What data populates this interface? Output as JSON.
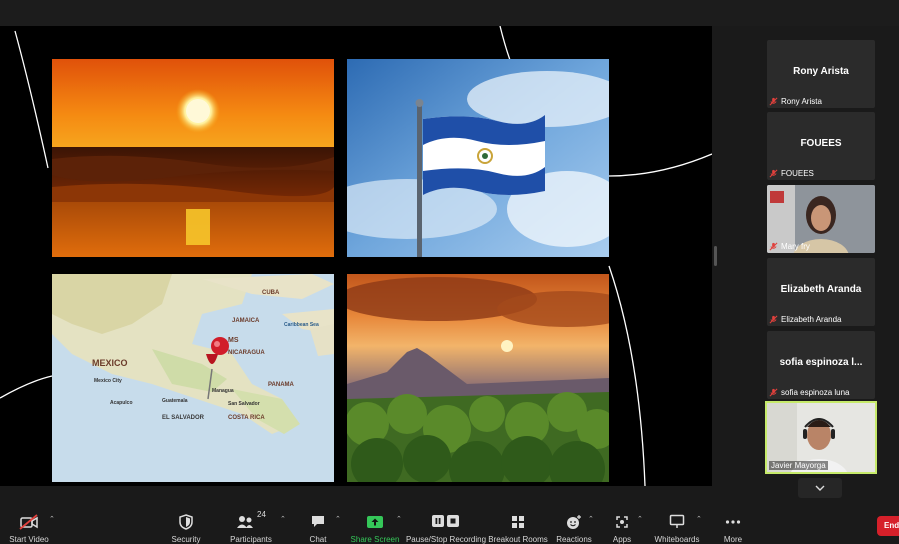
{
  "participants": [
    {
      "display_name": "Rony Arista",
      "label": "Rony Arista"
    },
    {
      "display_name": "FOUEES",
      "label": "FOUEES"
    },
    {
      "label": "Mary fry"
    },
    {
      "display_name": "Elizabeth Aranda",
      "label": "Elizabeth Aranda"
    },
    {
      "display_name": "sofia espinoza l...",
      "label": "sofia espinoza luna"
    }
  ],
  "self_view": {
    "label": "Javier Mayorga"
  },
  "toolbar": {
    "start_video": "Start Video",
    "security": "Security",
    "participants": "Participants",
    "participants_count": "24",
    "chat": "Chat",
    "share_screen": "Share Screen",
    "pause_recording": "Pause/Stop Recording",
    "breakout_rooms": "Breakout Rooms",
    "reactions": "Reactions",
    "apps": "Apps",
    "whiteboards": "Whiteboards",
    "more": "More",
    "end": "End"
  },
  "map_labels": {
    "mexico": "MEXICO",
    "mexico_city": "Mexico City",
    "guatemala": "Guatemala",
    "el_salvador": "EL SALVADOR",
    "san_salvador": "San Salvador",
    "nicaragua": "NICARAGUA",
    "managua": "Managua",
    "costa_rica": "COSTA RICA",
    "panama": "PANAMA",
    "jamaica": "JAMAICA",
    "caribbean_sea": "Caribbean Sea",
    "acapulco": "Acapulco",
    "cuba": "CUBA",
    "honduras": "MS"
  },
  "colors": {
    "accent_green": "#35c759",
    "self_border": "#c6ea6a",
    "end_red": "#d6202a",
    "muted_red": "#e0403c"
  }
}
